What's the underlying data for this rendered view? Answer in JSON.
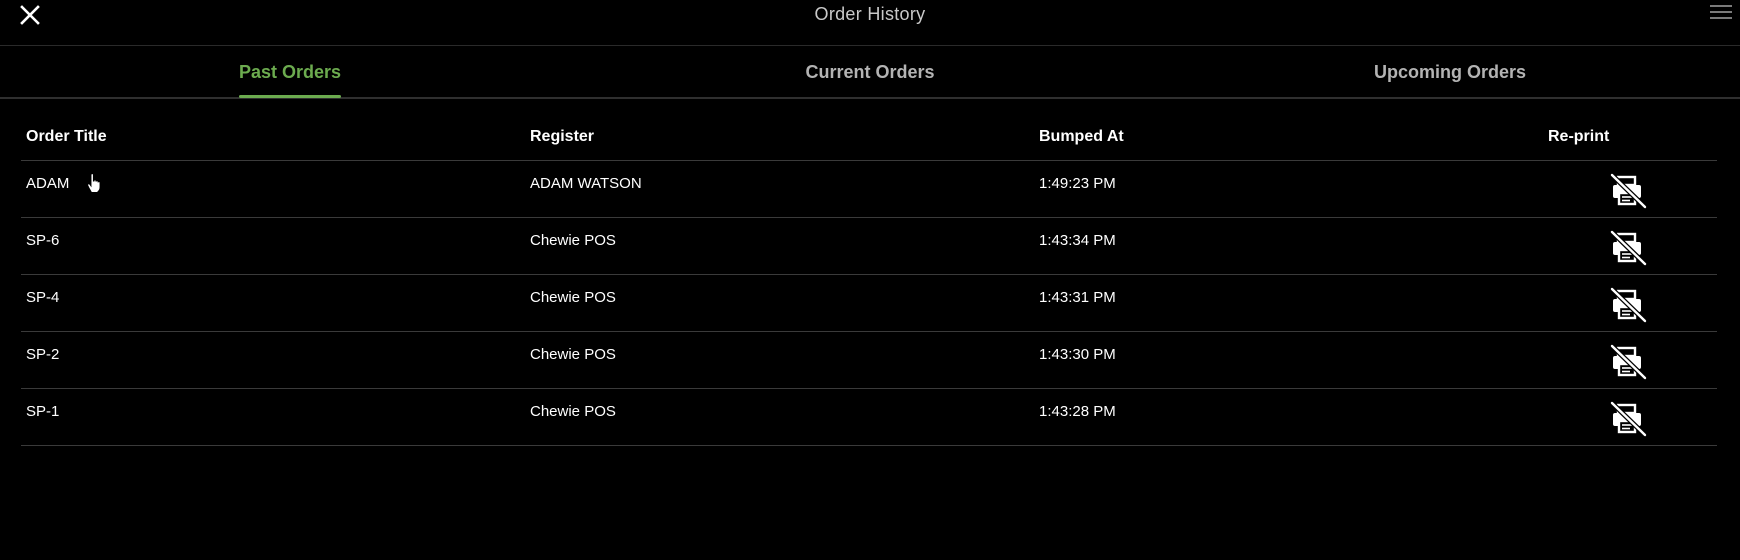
{
  "header": {
    "title": "Order History",
    "close_icon": "close-icon",
    "menu_icon": "hamburger-menu-icon"
  },
  "tabs": [
    {
      "label": "Past Orders",
      "active": true
    },
    {
      "label": "Current Orders",
      "active": false
    },
    {
      "label": "Upcoming Orders",
      "active": false
    }
  ],
  "table": {
    "columns": [
      "Order Title",
      "Register",
      "Bumped At",
      "Re-print"
    ],
    "rows": [
      {
        "order_title": "ADAM",
        "register": "ADAM WATSON",
        "bumped_at": "1:49:23 PM",
        "reprint_icon": "printer-off-icon"
      },
      {
        "order_title": "SP-6",
        "register": "Chewie POS",
        "bumped_at": "1:43:34 PM",
        "reprint_icon": "printer-off-icon"
      },
      {
        "order_title": "SP-4",
        "register": "Chewie POS",
        "bumped_at": "1:43:31 PM",
        "reprint_icon": "printer-off-icon"
      },
      {
        "order_title": "SP-2",
        "register": "Chewie POS",
        "bumped_at": "1:43:30 PM",
        "reprint_icon": "printer-off-icon"
      },
      {
        "order_title": "SP-1",
        "register": "Chewie POS",
        "bumped_at": "1:43:28 PM",
        "reprint_icon": "printer-off-icon"
      }
    ]
  },
  "colors": {
    "background": "#000000",
    "accent": "#6cab4f",
    "tab_inactive": "#b3b3b3",
    "divider": "#3a3a3a"
  }
}
